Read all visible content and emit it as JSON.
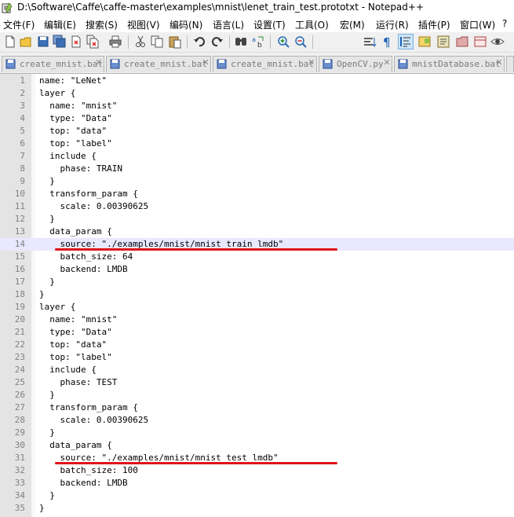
{
  "window": {
    "title": "D:\\Software\\Caffe\\caffe-master\\examples\\mnist\\lenet_train_test.prototxt - Notepad++"
  },
  "menu": [
    "文件(F)",
    "编辑(E)",
    "搜索(S)",
    "视图(V)",
    "编码(N)",
    "语言(L)",
    "设置(T)",
    "工具(O)",
    "宏(M)",
    "运行(R)",
    "插件(P)",
    "窗口(W)",
    "?"
  ],
  "toolbar": {
    "icons": [
      "new-file-icon",
      "open-file-icon",
      "save-icon",
      "save-all-icon",
      "close-icon",
      "close-all-icon",
      "print-icon",
      "cut-icon",
      "copy-icon",
      "paste-icon",
      "undo-icon",
      "redo-icon",
      "find-icon",
      "replace-icon",
      "zoom-in-icon",
      "zoom-out-icon",
      "sync-vertical-icon",
      "word-wrap-icon",
      "show-all-chars-icon",
      "indent-guide-icon",
      "doc-map-icon",
      "function-list-icon",
      "folder-as-workspace-icon",
      "monitoring-icon"
    ]
  },
  "tabs": [
    {
      "label": "create_mnist.bat",
      "active": false
    },
    {
      "label": "create_mnist.bat",
      "active": false
    },
    {
      "label": "create_mnist.bat",
      "active": false
    },
    {
      "label": "OpenCV.py",
      "active": false
    },
    {
      "label": "mnistDatabase.bat",
      "active": false
    }
  ],
  "editor": {
    "current_line": 14,
    "lines": [
      {
        "n": "1",
        "text": "name: \"LeNet\""
      },
      {
        "n": "2",
        "text": "layer {"
      },
      {
        "n": "3",
        "text": "  name: \"mnist\""
      },
      {
        "n": "4",
        "text": "  type: \"Data\""
      },
      {
        "n": "5",
        "text": "  top: \"data\""
      },
      {
        "n": "6",
        "text": "  top: \"label\""
      },
      {
        "n": "7",
        "text": "  include {"
      },
      {
        "n": "8",
        "text": "    phase: TRAIN"
      },
      {
        "n": "9",
        "text": "  }"
      },
      {
        "n": "10",
        "text": "  transform_param {"
      },
      {
        "n": "11",
        "text": "    scale: 0.00390625"
      },
      {
        "n": "12",
        "text": "  }"
      },
      {
        "n": "13",
        "text": "  data_param {"
      },
      {
        "n": "14",
        "text": "    source: \"./examples/mnist/mnist_train_lmdb\""
      },
      {
        "n": "15",
        "text": "    batch_size: 64"
      },
      {
        "n": "16",
        "text": "    backend: LMDB"
      },
      {
        "n": "17",
        "text": "  }"
      },
      {
        "n": "18",
        "text": "}"
      },
      {
        "n": "19",
        "text": "layer {"
      },
      {
        "n": "20",
        "text": "  name: \"mnist\""
      },
      {
        "n": "21",
        "text": "  type: \"Data\""
      },
      {
        "n": "22",
        "text": "  top: \"data\""
      },
      {
        "n": "23",
        "text": "  top: \"label\""
      },
      {
        "n": "24",
        "text": "  include {"
      },
      {
        "n": "25",
        "text": "    phase: TEST"
      },
      {
        "n": "26",
        "text": "  }"
      },
      {
        "n": "27",
        "text": "  transform_param {"
      },
      {
        "n": "28",
        "text": "    scale: 0.00390625"
      },
      {
        "n": "29",
        "text": "  }"
      },
      {
        "n": "30",
        "text": "  data_param {"
      },
      {
        "n": "31",
        "text": "    source: \"./examples/mnist/mnist_test_lmdb\""
      },
      {
        "n": "32",
        "text": "    batch_size: 100"
      },
      {
        "n": "33",
        "text": "    backend: LMDB"
      },
      {
        "n": "34",
        "text": "  }"
      },
      {
        "n": "35",
        "text": "}"
      }
    ],
    "annotations": [
      {
        "line": 14,
        "color": "#e0141c"
      },
      {
        "line": 31,
        "color": "#e0141c"
      }
    ]
  }
}
